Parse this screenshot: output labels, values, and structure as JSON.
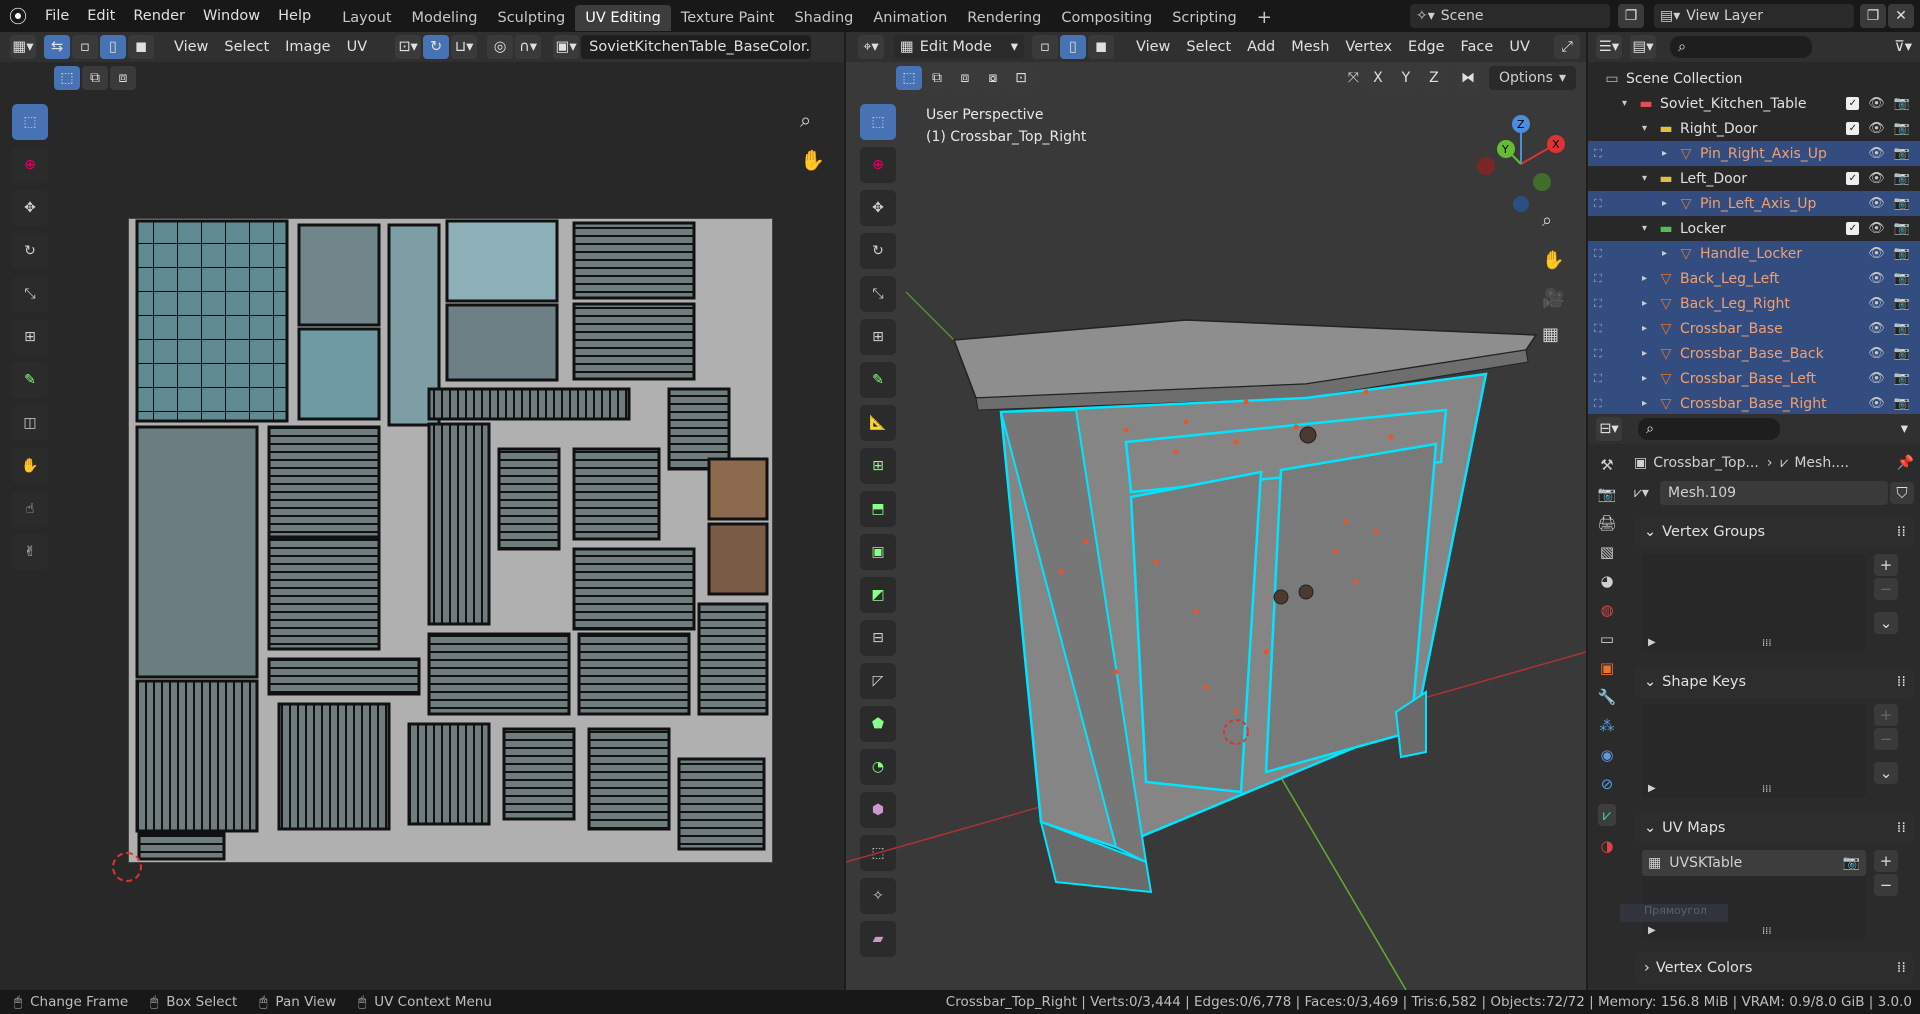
{
  "topbar": {
    "menus": [
      "File",
      "Edit",
      "Render",
      "Window",
      "Help"
    ],
    "workspaces": [
      "Layout",
      "Modeling",
      "Sculpting",
      "UV Editing",
      "Texture Paint",
      "Shading",
      "Animation",
      "Rendering",
      "Compositing",
      "Scripting"
    ],
    "active_workspace": "UV Editing",
    "add_tab": "+",
    "scene_label": "Scene",
    "view_layer_label": "View Layer"
  },
  "uv_editor": {
    "menus": [
      "View",
      "Select",
      "Image",
      "UV"
    ],
    "image_name": "SovietKitchenTable_BaseColor.png"
  },
  "viewport": {
    "mode": "Edit Mode",
    "menus": [
      "View",
      "Select",
      "Add",
      "Mesh",
      "Vertex",
      "Edge",
      "Face",
      "UV"
    ],
    "perspective_label": "User Perspective",
    "object_label": "(1) Crossbar_Top_Right",
    "axes": [
      "X",
      "Y",
      "Z"
    ],
    "options_label": "Options",
    "gizmo_labels": {
      "x": "X",
      "y": "Y",
      "z": "Z"
    },
    "selection_color": "#00e5ff"
  },
  "outliner": {
    "search_placeholder": "",
    "items": [
      {
        "label": "Scene Collection",
        "type": "scene",
        "indent": 0,
        "selected": false
      },
      {
        "label": "Soviet_Kitchen_Table",
        "type": "collection-red",
        "indent": 1,
        "selected": false
      },
      {
        "label": "Right_Door",
        "type": "collection-yellow",
        "indent": 2,
        "selected": false
      },
      {
        "label": "Pin_Right_Axis_Up",
        "type": "mesh",
        "indent": 3,
        "selected": true
      },
      {
        "label": "Left_Door",
        "type": "collection-yellow",
        "indent": 2,
        "selected": false
      },
      {
        "label": "Pin_Left_Axis_Up",
        "type": "mesh",
        "indent": 3,
        "selected": true
      },
      {
        "label": "Locker",
        "type": "collection-green",
        "indent": 2,
        "selected": false
      },
      {
        "label": "Handle_Locker",
        "type": "mesh",
        "indent": 3,
        "selected": true
      },
      {
        "label": "Back_Leg_Left",
        "type": "mesh",
        "indent": 2,
        "selected": true
      },
      {
        "label": "Back_Leg_Right",
        "type": "mesh",
        "indent": 2,
        "selected": true
      },
      {
        "label": "Crossbar_Base",
        "type": "mesh",
        "indent": 2,
        "selected": true
      },
      {
        "label": "Crossbar_Base_Back",
        "type": "mesh",
        "indent": 2,
        "selected": true
      },
      {
        "label": "Crossbar_Base_Left",
        "type": "mesh",
        "indent": 2,
        "selected": true
      },
      {
        "label": "Crossbar_Base_Right",
        "type": "mesh",
        "indent": 2,
        "selected": true
      }
    ]
  },
  "properties": {
    "breadcrumb_object": "Crossbar_Top...",
    "breadcrumb_mesh": "Mesh....",
    "mesh_name": "Mesh.109",
    "panels": {
      "vertex_groups": "Vertex Groups",
      "shape_keys": "Shape Keys",
      "uv_maps": "UV Maps",
      "vertex_colors": "Vertex Colors"
    },
    "uv_map_name": "UVSKTable",
    "tooltip_ghost": "Прямоугол"
  },
  "statusbar": {
    "left": [
      {
        "icon": "mouse-left-icon",
        "label": "Change Frame"
      },
      {
        "icon": "mouse-drag-icon",
        "label": "Box Select"
      },
      {
        "icon": "mouse-middle-icon",
        "label": "Pan View"
      },
      {
        "icon": "mouse-right-icon",
        "label": "UV Context Menu"
      }
    ],
    "stats": "Crossbar_Top_Right | Verts:0/3,444 | Edges:0/6,778 | Faces:0/3,469 | Tris:6,582 | Objects:72/72 | Memory: 156.8 MiB | VRAM: 0.9/8.0 GiB | 3.0.0"
  }
}
